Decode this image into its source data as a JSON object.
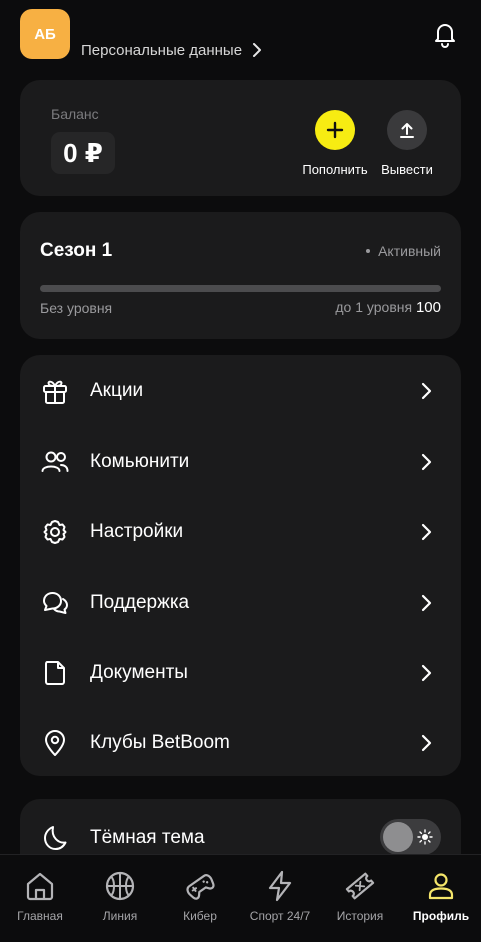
{
  "header": {
    "avatar_initials": "АБ",
    "personal_data_label": "Персональные данные",
    "bell_icon": "bell-icon"
  },
  "balance": {
    "label": "Баланс",
    "value": "0 ₽",
    "deposit_label": "Пополнить",
    "withdraw_label": "Вывести"
  },
  "season": {
    "title": "Сезон 1",
    "status": "Активный",
    "level_left": "Без уровня",
    "level_right_prefix": "до 1 уровня",
    "level_right_value": "100",
    "progress_fraction": 0
  },
  "menu": {
    "items": [
      {
        "label": "Акции",
        "icon": "gift-icon"
      },
      {
        "label": "Комьюнити",
        "icon": "users-icon"
      },
      {
        "label": "Настройки",
        "icon": "gear-icon"
      },
      {
        "label": "Поддержка",
        "icon": "chat-bubbles-icon"
      },
      {
        "label": "Документы",
        "icon": "document-icon"
      },
      {
        "label": "Клубы BetBoom",
        "icon": "location-pin-icon"
      }
    ]
  },
  "theme": {
    "label": "Тёмная тема",
    "enabled": false
  },
  "nav": {
    "items": [
      {
        "label": "Главная",
        "icon": "home-icon",
        "active": false
      },
      {
        "label": "Линия",
        "icon": "basketball-icon",
        "active": false
      },
      {
        "label": "Кибер",
        "icon": "gamepad-icon",
        "active": false
      },
      {
        "label": "Спорт 24/7",
        "icon": "lightning-icon",
        "active": false
      },
      {
        "label": "История",
        "icon": "ticket-icon",
        "active": false
      },
      {
        "label": "Профиль",
        "icon": "profile-icon",
        "active": true
      }
    ]
  },
  "colors": {
    "accent": "#f7ec12",
    "avatar": "#f7b043",
    "card": "#1b1b1c",
    "background": "#0c0c0d",
    "active_nav_icon": "#f5e66a"
  }
}
